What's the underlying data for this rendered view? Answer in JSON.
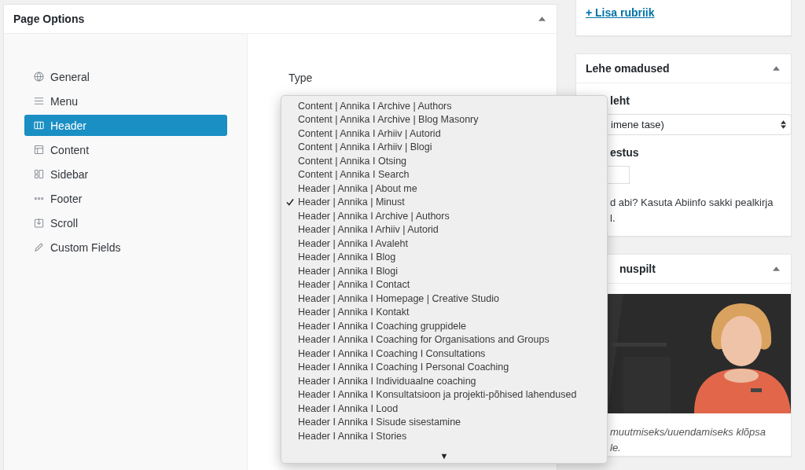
{
  "page_options": {
    "title": "Page Options",
    "nav": [
      {
        "label": "General",
        "selected": false
      },
      {
        "label": "Menu",
        "selected": false
      },
      {
        "label": "Header",
        "selected": true
      },
      {
        "label": "Content",
        "selected": false
      },
      {
        "label": "Sidebar",
        "selected": false
      },
      {
        "label": "Footer",
        "selected": false
      },
      {
        "label": "Scroll",
        "selected": false
      },
      {
        "label": "Custom Fields",
        "selected": false
      }
    ],
    "type_label": "Type",
    "dropdown": {
      "options": [
        {
          "label": "Content | Annika I Archive | Authors",
          "selected": false
        },
        {
          "label": "Content | Annika I Archive | Blog Masonry",
          "selected": false
        },
        {
          "label": "Content | Annika I Arhiiv | Autorid",
          "selected": false
        },
        {
          "label": "Content | Annika I Arhiiv | Blogi",
          "selected": false
        },
        {
          "label": "Content | Annika I Otsing",
          "selected": false
        },
        {
          "label": "Content | Annika I Search",
          "selected": false
        },
        {
          "label": "Header | Annika | About me",
          "selected": false
        },
        {
          "label": "Header | Annika | Minust",
          "selected": true
        },
        {
          "label": "Header | Annika I Archive | Authors",
          "selected": false
        },
        {
          "label": "Header | Annika I Arhiiv | Autorid",
          "selected": false
        },
        {
          "label": "Header | Annika I Avaleht",
          "selected": false
        },
        {
          "label": "Header | Annika I Blog",
          "selected": false
        },
        {
          "label": "Header | Annika I Blogi",
          "selected": false
        },
        {
          "label": "Header | Annika I Contact",
          "selected": false
        },
        {
          "label": "Header | Annika I Homepage | Creative Studio",
          "selected": false
        },
        {
          "label": "Header | Annika I Kontakt",
          "selected": false
        },
        {
          "label": "Header I Annika I Coaching gruppidele",
          "selected": false
        },
        {
          "label": "Header I Annika I Coaching for Organisations and Groups",
          "selected": false
        },
        {
          "label": "Header I Annika I Coaching I Consultations",
          "selected": false
        },
        {
          "label": "Header I Annika I Coaching I Personal Coaching",
          "selected": false
        },
        {
          "label": "Header I Annika I Individuaalne coaching",
          "selected": false
        },
        {
          "label": "Header I Annika I Konsultatsioon ja projekti-põhised lahendused",
          "selected": false
        },
        {
          "label": "Header I Annika I Lood",
          "selected": false
        },
        {
          "label": "Header I Annika I Sisude sisestamine",
          "selected": false
        },
        {
          "label": "Header I Annika I Stories",
          "selected": false
        }
      ],
      "scroll_arrow": "▼"
    }
  },
  "sidebar": {
    "category_link": "+ Lisa rubriik",
    "page_attributes": {
      "title": "Lehe omadused",
      "parent_label": "leht",
      "parent_value": "imene tase)",
      "order_label": "estus",
      "help": [
        "d abi? Kasuta Abiinfo sakki pealkirja",
        "l."
      ]
    },
    "featured_image": {
      "title": "nuspilt",
      "hint": [
        "muutmiseks/uuendamiseks klõpsa",
        "le."
      ]
    }
  }
}
